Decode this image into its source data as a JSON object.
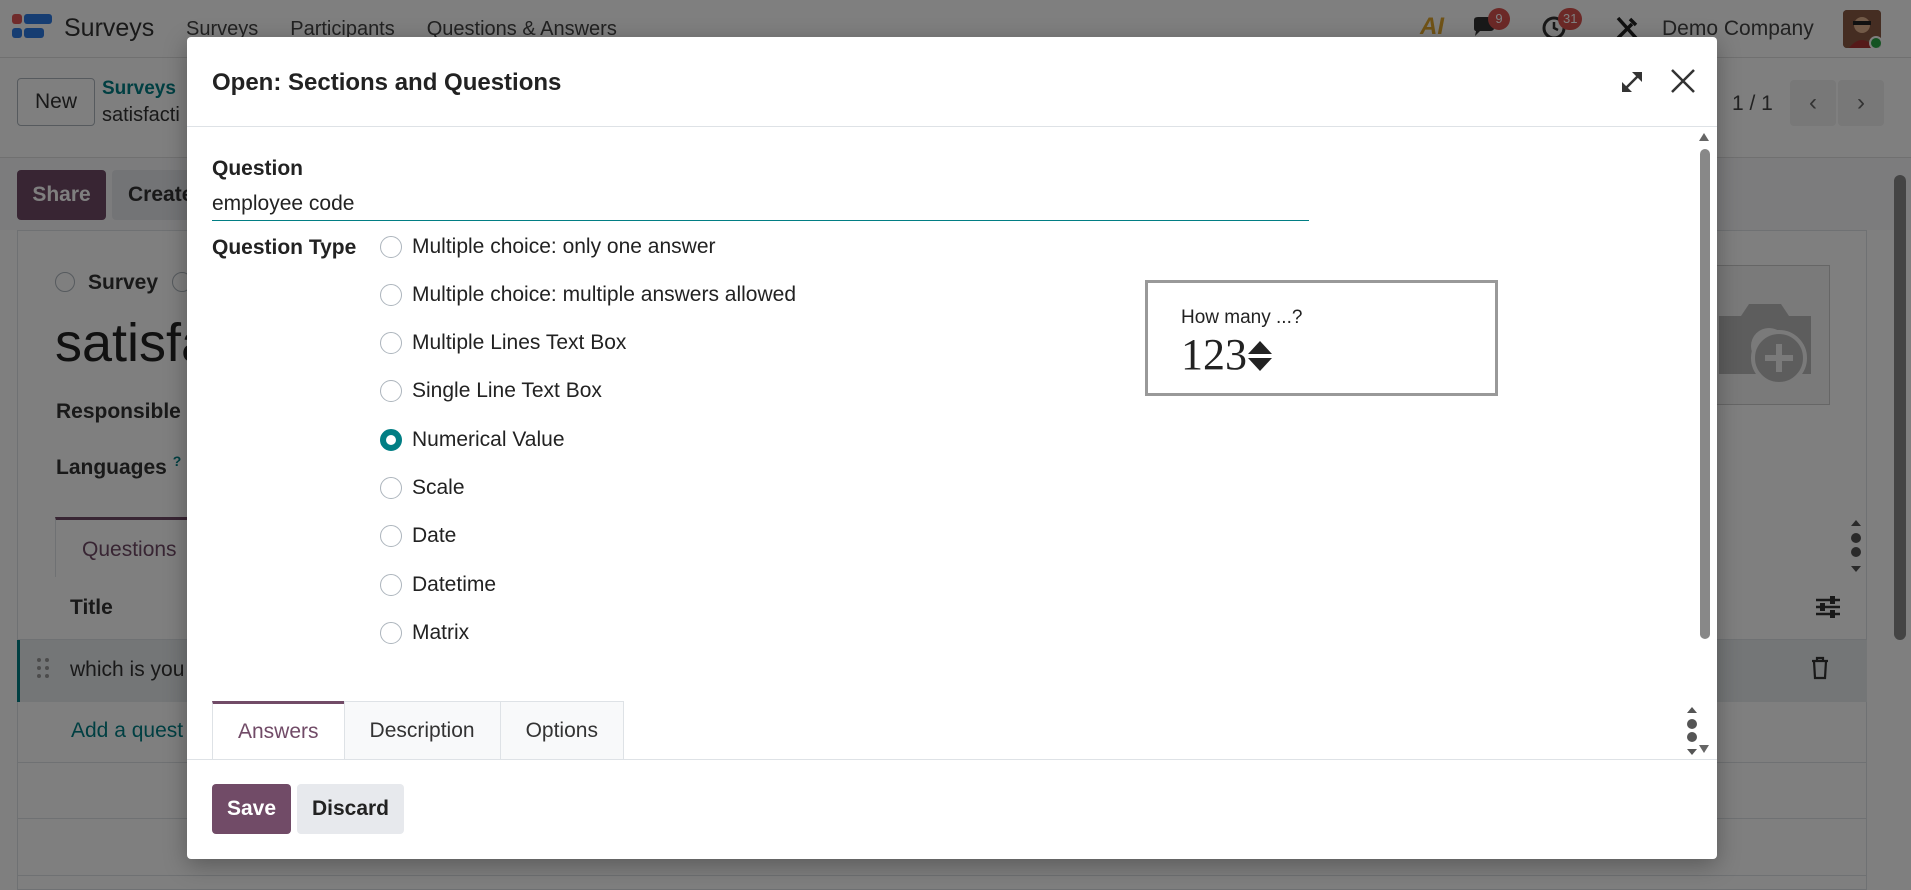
{
  "app": {
    "brand": "Surveys",
    "menu": [
      "Surveys",
      "Participants",
      "Questions & Answers"
    ],
    "ai_label": "AI",
    "chat_badge": "9",
    "activity_badge": "31",
    "company": "Demo Company"
  },
  "control_bar": {
    "new_label": "New",
    "breadcrumb_link": "Surveys",
    "breadcrumb_current": "satisfacti",
    "pager": "1 / 1"
  },
  "status_bar": {
    "share_label": "Share",
    "create_label": "Create"
  },
  "form": {
    "survey_radio_label": "Survey",
    "title": "satisfa",
    "responsible_label": "Responsible",
    "languages_label": "Languages",
    "languages_help": "?",
    "tab_questions": "Questions",
    "col_title": "Title",
    "row_text": "which is you",
    "add_question": "Add a quest"
  },
  "modal": {
    "title": "Open: Sections and Questions",
    "question_label": "Question",
    "question_value": "employee code",
    "question_type_label": "Question Type",
    "question_types": [
      {
        "label": "Multiple choice: only one answer",
        "checked": false
      },
      {
        "label": "Multiple choice: multiple answers allowed",
        "checked": false
      },
      {
        "label": "Multiple Lines Text Box",
        "checked": false
      },
      {
        "label": "Single Line Text Box",
        "checked": false
      },
      {
        "label": "Numerical Value",
        "checked": true
      },
      {
        "label": "Scale",
        "checked": false
      },
      {
        "label": "Date",
        "checked": false
      },
      {
        "label": "Datetime",
        "checked": false
      },
      {
        "label": "Matrix",
        "checked": false
      }
    ],
    "preview": {
      "question": "How many ...?",
      "number": "123"
    },
    "tabs": [
      {
        "label": "Answers",
        "active": true
      },
      {
        "label": "Description",
        "active": false
      },
      {
        "label": "Options",
        "active": false
      }
    ],
    "save_label": "Save",
    "discard_label": "Discard"
  },
  "colors": {
    "primary": "#714b67",
    "accent": "#017e84",
    "badge": "#d9534f"
  }
}
